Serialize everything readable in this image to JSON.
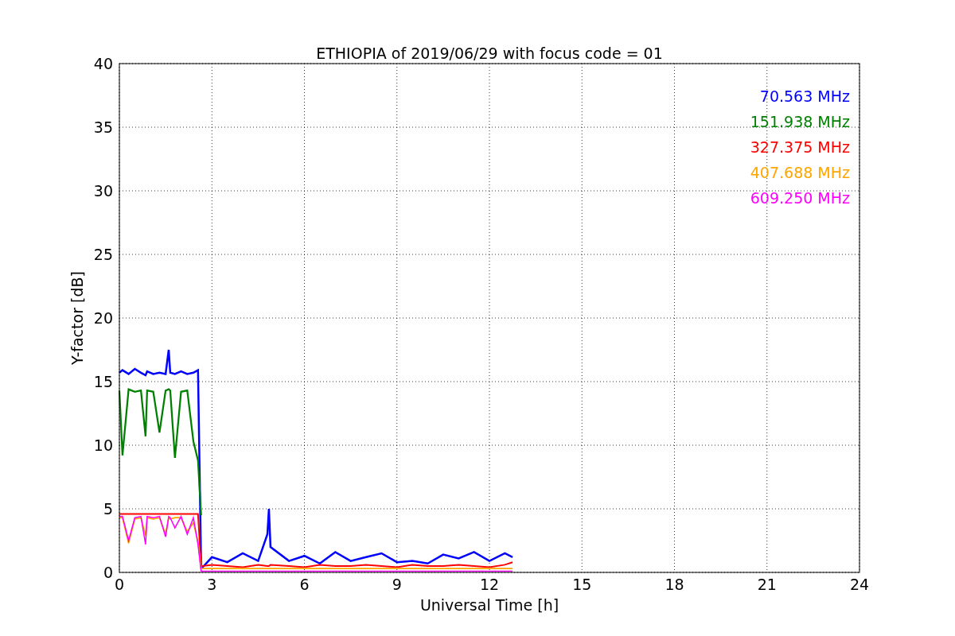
{
  "figure": {
    "chart_data": {
      "type": "line",
      "title": "ETHIOPIA of 2019/06/29 with focus code = 01",
      "xlabel": "Universal Time [h]",
      "ylabel": "Y-factor [dB]",
      "x": [
        0,
        0.1,
        0.3,
        0.5,
        0.7,
        0.85,
        0.9,
        1.1,
        1.3,
        1.5,
        1.6,
        1.65,
        1.8,
        2.0,
        2.2,
        2.4,
        2.55,
        2.65,
        2.7,
        3.0,
        3.5,
        4.0,
        4.5,
        4.8,
        4.85,
        4.9,
        5.5,
        6,
        6.5,
        7,
        7.5,
        8,
        8.5,
        9,
        9.5,
        10,
        10.5,
        11,
        11.5,
        12,
        12.5,
        12.75
      ],
      "grid": true,
      "xlim": [
        0,
        24
      ],
      "ylim": [
        0,
        40
      ],
      "xticks": [
        0,
        3,
        6,
        9,
        12,
        15,
        18,
        21,
        24
      ],
      "yticks": [
        0,
        5,
        10,
        15,
        20,
        25,
        30,
        35,
        40
      ],
      "series": [
        {
          "name": "70.563 MHz",
          "color": "#0000ff",
          "values": [
            15.7,
            15.9,
            15.6,
            16.0,
            15.7,
            15.5,
            15.8,
            15.6,
            15.7,
            15.6,
            17.5,
            15.7,
            15.6,
            15.8,
            15.6,
            15.7,
            15.9,
            0.5,
            0.4,
            1.2,
            0.8,
            1.5,
            0.9,
            3.0,
            5.0,
            2.0,
            0.9,
            1.3,
            0.7,
            1.6,
            0.9,
            1.2,
            1.5,
            0.8,
            0.9,
            0.7,
            1.4,
            1.1,
            1.6,
            0.9,
            1.5,
            1.2
          ]
        },
        {
          "name": "151.938 MHz",
          "color": "#008000",
          "values": [
            14.3,
            9.2,
            14.4,
            14.2,
            14.3,
            10.7,
            14.3,
            14.2,
            11.0,
            14.3,
            14.4,
            14.3,
            9.0,
            14.2,
            14.3,
            10.3,
            8.8,
            4.5,
            null,
            null,
            null,
            null,
            null,
            null,
            null,
            null,
            null,
            null,
            null,
            null,
            null,
            null,
            null,
            null,
            null,
            null,
            null,
            null,
            null,
            null,
            null,
            null
          ]
        },
        {
          "name": "327.375 MHz",
          "color": "#ff0000",
          "values": [
            4.6,
            4.6,
            4.6,
            4.6,
            4.6,
            4.6,
            4.6,
            4.6,
            4.6,
            4.6,
            4.6,
            4.6,
            4.6,
            4.6,
            4.6,
            4.6,
            4.6,
            0.5,
            0.5,
            0.6,
            0.5,
            0.4,
            0.6,
            0.5,
            0.5,
            0.6,
            0.5,
            0.4,
            0.6,
            0.5,
            0.5,
            0.6,
            0.5,
            0.4,
            0.6,
            0.5,
            0.5,
            0.6,
            0.5,
            0.4,
            0.6,
            0.8
          ]
        },
        {
          "name": "407.688 MHz",
          "color": "#ffa500",
          "values": [
            4.3,
            4.3,
            2.3,
            4.2,
            4.3,
            2.9,
            4.3,
            4.2,
            4.3,
            3.0,
            4.3,
            4.2,
            4.3,
            4.3,
            3.2,
            3.9,
            2.4,
            0.3,
            0.3,
            0.3,
            0.3,
            0.3,
            0.3,
            0.3,
            0.3,
            0.3,
            0.3,
            0.3,
            0.3,
            0.3,
            0.3,
            0.3,
            0.3,
            0.3,
            0.3,
            0.3,
            0.3,
            0.3,
            0.3,
            0.3,
            0.3,
            0.3
          ]
        },
        {
          "name": "609.250 MHz",
          "color": "#ff00ff",
          "values": [
            4.4,
            4.4,
            2.5,
            4.3,
            4.4,
            2.2,
            4.4,
            4.3,
            4.4,
            2.8,
            4.4,
            4.3,
            3.5,
            4.4,
            3.0,
            4.3,
            2.2,
            0.1,
            0.1,
            0.1,
            0.1,
            0.1,
            0.1,
            0.1,
            0.1,
            0.1,
            0.1,
            0.1,
            0.1,
            0.1,
            0.1,
            0.1,
            0.1,
            0.1,
            0.1,
            0.1,
            0.1,
            0.1,
            0.1,
            0.1,
            0.1,
            0.1
          ]
        }
      ]
    }
  }
}
